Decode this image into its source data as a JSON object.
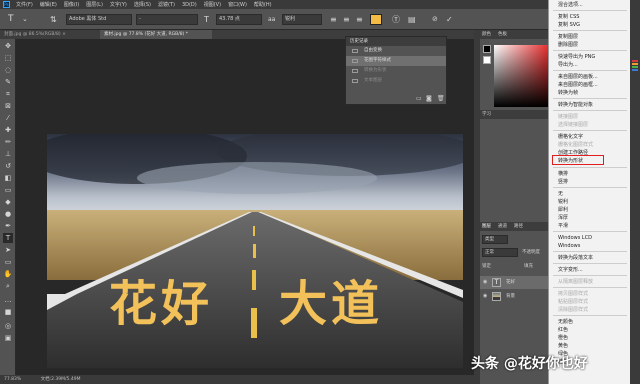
{
  "app": {
    "logo": "Ps"
  },
  "menu": [
    "文件(F)",
    "编辑(E)",
    "图像(I)",
    "图层(L)",
    "文字(Y)",
    "选择(S)",
    "滤镜(T)",
    "3D(D)",
    "视图(V)",
    "窗口(W)",
    "帮助(H)"
  ],
  "options": {
    "font_family": "Adobe 黑体 Std",
    "font_style": "-",
    "font_size": "43.78 点",
    "antialias": "锐利",
    "text_color": "#f5bc45"
  },
  "tabs": [
    {
      "label": "封面.jpg @ 86.5%(RGB/8) ×",
      "active": false
    },
    {
      "label": "素材.jpg @ 77.8% (花好  大道, RGB/8) *",
      "active": true
    }
  ],
  "canvas": {
    "text_left": "花好",
    "text_right": "大道",
    "text_color": "#f2c15a"
  },
  "history": {
    "title": "历史记录",
    "items": [
      {
        "label": "自由变换",
        "state": "normal"
      },
      {
        "label": "花图字符样式",
        "state": "active"
      },
      {
        "label": "转换为形状",
        "state": "undone"
      },
      {
        "label": "文本图层",
        "state": "undone"
      }
    ]
  },
  "dock": {
    "color_tab": "颜色",
    "swatch_tab": "色板",
    "learn_tab": "学习",
    "layers_tab": "图层",
    "channels_tab": "通道",
    "paths_tab": "路径",
    "filter_kind": "类型",
    "blend_mode": "正常",
    "opacity_label": "不透明度",
    "lock_label": "锁定",
    "fill_label": "填充",
    "layers": [
      {
        "name": "花好",
        "thumb": "T",
        "selected": true
      },
      {
        "name": "背景",
        "thumb": "",
        "selected": false
      }
    ]
  },
  "context_menu": {
    "items": [
      {
        "label": "混合选项...",
        "enabled": true
      },
      {
        "label": "复制 CSS",
        "enabled": true
      },
      {
        "label": "复制 SVG",
        "enabled": true
      },
      {
        "label": "复制图层",
        "enabled": true
      },
      {
        "label": "删除图层",
        "enabled": true
      },
      {
        "label": "快速导出为 PNG",
        "enabled": true
      },
      {
        "label": "导出为...",
        "enabled": true
      },
      {
        "label": "来自图层的画板...",
        "enabled": true
      },
      {
        "label": "来自图层的画框...",
        "enabled": true
      },
      {
        "label": "转换为帧",
        "enabled": true
      },
      {
        "label": "转换为智能对象",
        "enabled": true
      },
      {
        "label": "链接图层",
        "enabled": false
      },
      {
        "label": "选择链接图层",
        "enabled": false
      },
      {
        "label": "栅格化文字",
        "enabled": true
      },
      {
        "label": "栅格化图层样式",
        "enabled": false
      },
      {
        "label": "创建工作路径",
        "enabled": true
      },
      {
        "label": "转换为形状",
        "enabled": true
      },
      {
        "label": "横排",
        "enabled": true
      },
      {
        "label": "竖排",
        "enabled": true
      },
      {
        "label": "无",
        "enabled": true
      },
      {
        "label": "锐利",
        "enabled": true
      },
      {
        "label": "犀利",
        "enabled": true
      },
      {
        "label": "浑厚",
        "enabled": true
      },
      {
        "label": "平滑",
        "enabled": true
      },
      {
        "label": "Windows LCD",
        "enabled": true
      },
      {
        "label": "Windows",
        "enabled": true
      },
      {
        "label": "转换为段落文本",
        "enabled": true
      },
      {
        "label": "文字变形...",
        "enabled": true
      },
      {
        "label": "从隔离图层释放",
        "enabled": false
      },
      {
        "label": "拷贝图层样式",
        "enabled": false
      },
      {
        "label": "粘贴图层样式",
        "enabled": false
      },
      {
        "label": "清除图层样式",
        "enabled": false
      },
      {
        "label": "无颜色",
        "enabled": true
      },
      {
        "label": "红色",
        "enabled": true
      },
      {
        "label": "橙色",
        "enabled": true
      },
      {
        "label": "黄色",
        "enabled": true
      },
      {
        "label": "绿色",
        "enabled": true
      },
      {
        "label": "蓝色",
        "enabled": true
      }
    ],
    "highlighted": "转换为形状"
  },
  "status": {
    "zoom": "77.83%",
    "doc": "文档:2.39M/5.49M"
  },
  "watermark": "头条 @花好你也好"
}
